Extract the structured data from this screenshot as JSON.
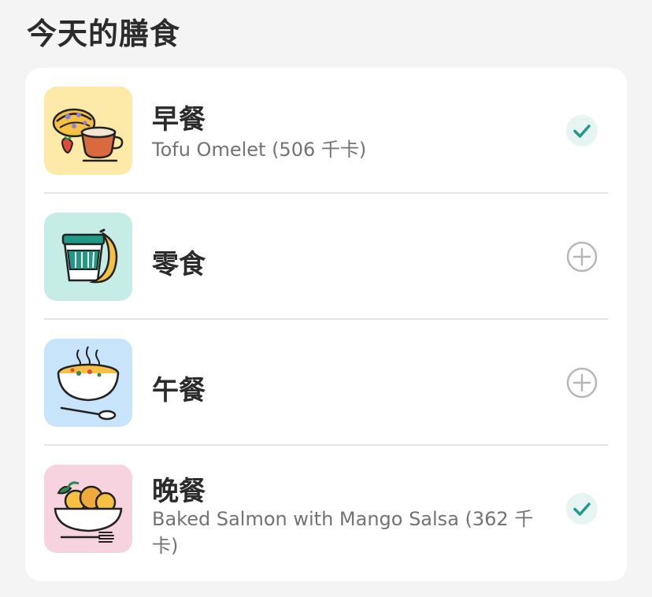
{
  "section": {
    "title": "今天的膳食"
  },
  "meals": [
    {
      "name": "早餐",
      "description": "Tofu Omelet (506 千卡)",
      "status": "logged",
      "icon": "breakfast-coffee-pastry-icon",
      "thumb_color": "#fde9a8"
    },
    {
      "name": "零食",
      "description": "",
      "status": "add",
      "icon": "snack-cup-banana-icon",
      "thumb_color": "#c6ece6"
    },
    {
      "name": "午餐",
      "description": "",
      "status": "add",
      "icon": "lunch-soup-bowl-icon",
      "thumb_color": "#c8e4fa"
    },
    {
      "name": "晚餐",
      "description": "Baked Salmon with Mango Salsa (362 千卡)",
      "status": "logged",
      "icon": "dinner-plate-fork-icon",
      "thumb_color": "#f7d3e0"
    }
  ],
  "colors": {
    "check_accent": "#1f9b85",
    "check_bg": "#e6f5f2",
    "add_icon": "#b7b7b7"
  }
}
